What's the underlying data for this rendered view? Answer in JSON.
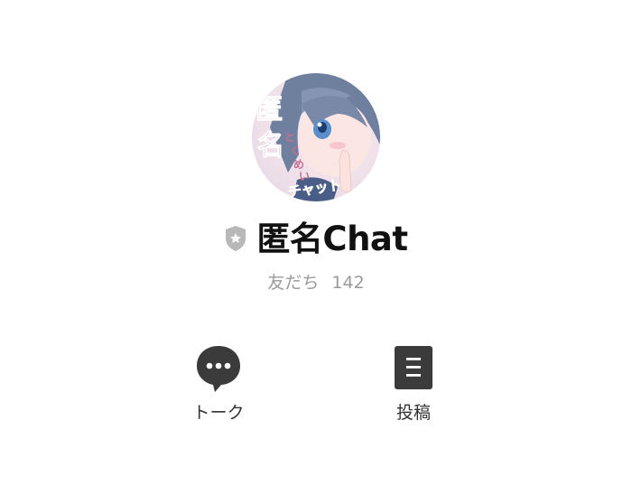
{
  "profile": {
    "avatar_icon": "anime-girl-avatar",
    "avatar_title": "匿名",
    "avatar_subtitle": "とくめい",
    "avatar_tag": "チャット",
    "badge_icon": "shield-star-icon",
    "name": "匿名Chat",
    "friends_label": "友だち",
    "friends_count": "142"
  },
  "actions": [
    {
      "icon": "speech-bubble-icon",
      "label": "トーク"
    },
    {
      "icon": "document-icon",
      "label": "投稿"
    }
  ],
  "colors": {
    "background": "#ffffff",
    "text": "#111111",
    "muted": "#9a9a9a",
    "icon": "#3b3b3b",
    "badge": "#b8b8b8"
  }
}
